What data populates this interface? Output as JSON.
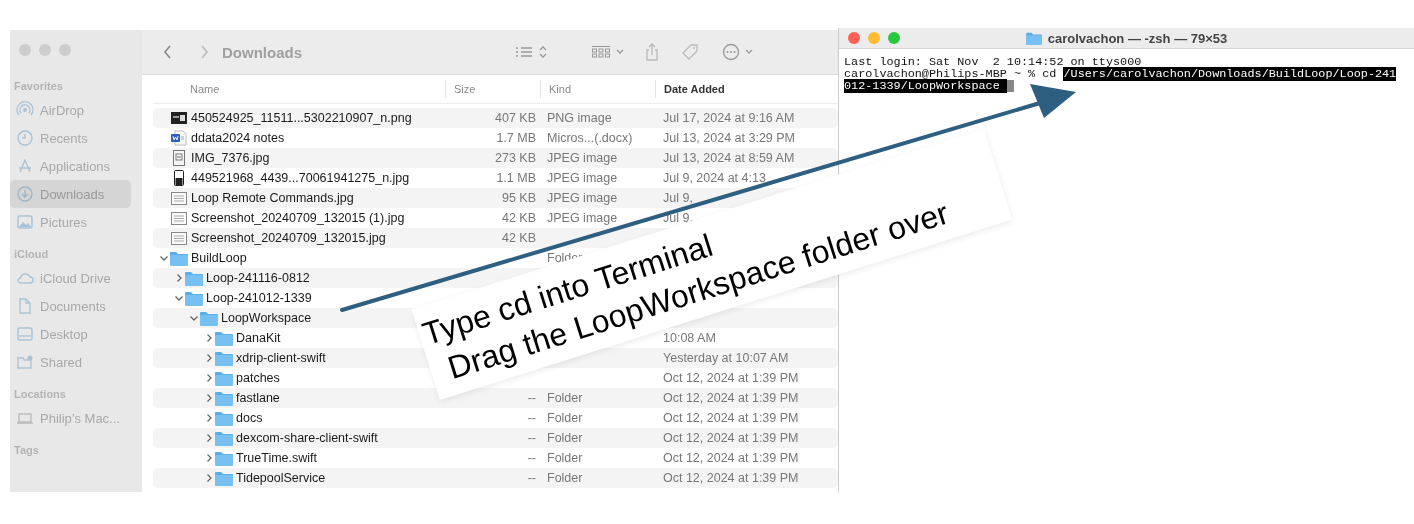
{
  "finder": {
    "active": false,
    "title": "Downloads",
    "sidebar": [
      {
        "heading": "Favorites",
        "items": [
          {
            "label": "AirDrop",
            "kind": "airdrop",
            "selected": false
          },
          {
            "label": "Recents",
            "kind": "clock",
            "selected": false
          },
          {
            "label": "Applications",
            "kind": "apps",
            "selected": false
          },
          {
            "label": "Downloads",
            "kind": "download",
            "selected": true
          },
          {
            "label": "Pictures",
            "kind": "pictures",
            "selected": false
          }
        ]
      },
      {
        "heading": "iCloud",
        "items": [
          {
            "label": "iCloud Drive",
            "kind": "cloud",
            "selected": false
          },
          {
            "label": "Documents",
            "kind": "document",
            "selected": false
          },
          {
            "label": "Desktop",
            "kind": "desktop",
            "selected": false
          },
          {
            "label": "Shared",
            "kind": "shared",
            "selected": false
          }
        ]
      },
      {
        "heading": "Locations",
        "items": [
          {
            "label": "Philip’s Mac...",
            "kind": "laptop",
            "selected": false
          }
        ]
      },
      {
        "heading": "Tags"
      }
    ],
    "columns": [
      {
        "label": "Name",
        "sorted": false
      },
      {
        "label": "Size",
        "sorted": false
      },
      {
        "label": "Kind",
        "sorted": false
      },
      {
        "label": "Date Added",
        "sorted": true
      }
    ],
    "rows": [
      {
        "kind": "image",
        "name": "450524925_11511...5302210907_n.png",
        "size": "407 KB",
        "file_type": "PNG image",
        "date": "Jul 17, 2024 at 9:16 AM"
      },
      {
        "kind": "word",
        "name": "ddata2024 notes",
        "size": "1.7 MB",
        "file_type": "Micros...(.docx)",
        "date": "Jul 13, 2024 at 3:29 PM"
      },
      {
        "kind": "jpeg",
        "name": "IMG_7376.jpg",
        "size": "273 KB",
        "file_type": "JPEG image",
        "date": "Jul 13, 2024 at 8:59 AM"
      },
      {
        "kind": "phone",
        "name": "449521968_4439...70061941275_n.jpg",
        "size": "1.1 MB",
        "file_type": "JPEG image",
        "date": "Jul 9, 2024 at 4:13"
      },
      {
        "kind": "text",
        "name": "Loop Remote Commands.jpg",
        "size": "95 KB",
        "file_type": "JPEG image",
        "date": "Jul 9,"
      },
      {
        "kind": "text",
        "name": "Screenshot_20240709_132015 (1).jpg",
        "size": "42 KB",
        "file_type": "JPEG image",
        "date": "Jul 9,"
      },
      {
        "kind": "text",
        "name": "Screenshot_20240709_132015.jpg",
        "size": "42 KB"
      },
      {
        "kind": "folder",
        "name": "BuildLoop",
        "file_type": "Folder",
        "expanded": true,
        "children": [
          {
            "kind": "folder",
            "name": "Loop-241116-0812",
            "expanded": false
          },
          {
            "kind": "folder",
            "name": "Loop-241012-1339",
            "expanded": true,
            "children": [
              {
                "kind": "folder",
                "name": "LoopWorkspace",
                "expanded": true,
                "children": [
                  {
                    "kind": "folder",
                    "name": "DanaKit",
                    "expanded": false,
                    "date": "10:08 AM"
                  },
                  {
                    "kind": "folder",
                    "name": "xdrip-client-swift",
                    "expanded": false,
                    "date": "Yesterday at 10:07 AM"
                  },
                  {
                    "kind": "folder",
                    "name": "patches",
                    "expanded": false,
                    "date": "Oct 12, 2024 at 1:39 PM"
                  },
                  {
                    "kind": "folder",
                    "name": "fastlane",
                    "expanded": false,
                    "size": "--",
                    "file_type": "Folder",
                    "date": "Oct 12, 2024 at 1:39 PM"
                  },
                  {
                    "kind": "folder",
                    "name": "docs",
                    "expanded": false,
                    "size": "--",
                    "file_type": "Folder",
                    "date": "Oct 12, 2024 at 1:39 PM"
                  },
                  {
                    "kind": "folder",
                    "name": "dexcom-share-client-swift",
                    "expanded": false,
                    "size": "--",
                    "file_type": "Folder",
                    "date": "Oct 12, 2024 at 1:39 PM"
                  },
                  {
                    "kind": "folder",
                    "name": "TrueTime.swift",
                    "expanded": false,
                    "size": "--",
                    "file_type": "Folder",
                    "date": "Oct 12, 2024 at 1:39 PM"
                  },
                  {
                    "kind": "folder",
                    "name": "TidepoolService",
                    "expanded": false,
                    "size": "--",
                    "file_type": "Folder",
                    "date": "Oct 12, 2024 at 1:39 PM"
                  }
                ]
              }
            ]
          }
        ]
      }
    ]
  },
  "terminal": {
    "active": true,
    "title": "carolvachon — -zsh — 79×53",
    "lines": [
      {
        "text": "Last login: Sat Nov  2 10:14:52 on ttys000"
      },
      {
        "text": "carolvachon@Philips-MBP ~ % cd ",
        "selection": "/Users/carolvachon/Downloads/BuildLoop/Loop-241012-1339/LoopWorkspace ",
        "cursor": true
      }
    ]
  },
  "annotation": {
    "lines": [
      "Type cd into Terminal",
      "Drag the LoopWorkspace folder over"
    ]
  }
}
